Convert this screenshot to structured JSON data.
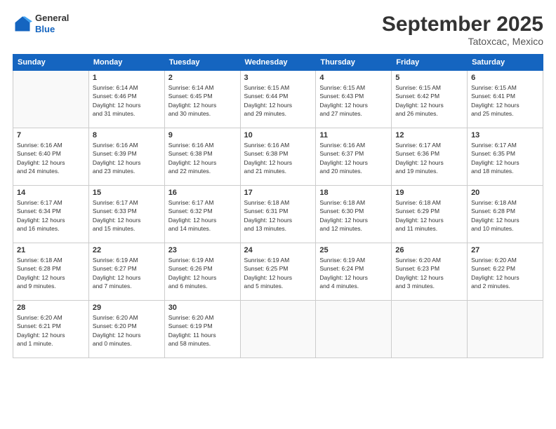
{
  "logo": {
    "line1": "General",
    "line2": "Blue"
  },
  "title": "September 2025",
  "subtitle": "Tatoxcac, Mexico",
  "days_of_week": [
    "Sunday",
    "Monday",
    "Tuesday",
    "Wednesday",
    "Thursday",
    "Friday",
    "Saturday"
  ],
  "weeks": [
    [
      {
        "day": "",
        "info": ""
      },
      {
        "day": "1",
        "info": "Sunrise: 6:14 AM\nSunset: 6:46 PM\nDaylight: 12 hours\nand 31 minutes."
      },
      {
        "day": "2",
        "info": "Sunrise: 6:14 AM\nSunset: 6:45 PM\nDaylight: 12 hours\nand 30 minutes."
      },
      {
        "day": "3",
        "info": "Sunrise: 6:15 AM\nSunset: 6:44 PM\nDaylight: 12 hours\nand 29 minutes."
      },
      {
        "day": "4",
        "info": "Sunrise: 6:15 AM\nSunset: 6:43 PM\nDaylight: 12 hours\nand 27 minutes."
      },
      {
        "day": "5",
        "info": "Sunrise: 6:15 AM\nSunset: 6:42 PM\nDaylight: 12 hours\nand 26 minutes."
      },
      {
        "day": "6",
        "info": "Sunrise: 6:15 AM\nSunset: 6:41 PM\nDaylight: 12 hours\nand 25 minutes."
      }
    ],
    [
      {
        "day": "7",
        "info": "Sunrise: 6:16 AM\nSunset: 6:40 PM\nDaylight: 12 hours\nand 24 minutes."
      },
      {
        "day": "8",
        "info": "Sunrise: 6:16 AM\nSunset: 6:39 PM\nDaylight: 12 hours\nand 23 minutes."
      },
      {
        "day": "9",
        "info": "Sunrise: 6:16 AM\nSunset: 6:38 PM\nDaylight: 12 hours\nand 22 minutes."
      },
      {
        "day": "10",
        "info": "Sunrise: 6:16 AM\nSunset: 6:38 PM\nDaylight: 12 hours\nand 21 minutes."
      },
      {
        "day": "11",
        "info": "Sunrise: 6:16 AM\nSunset: 6:37 PM\nDaylight: 12 hours\nand 20 minutes."
      },
      {
        "day": "12",
        "info": "Sunrise: 6:17 AM\nSunset: 6:36 PM\nDaylight: 12 hours\nand 19 minutes."
      },
      {
        "day": "13",
        "info": "Sunrise: 6:17 AM\nSunset: 6:35 PM\nDaylight: 12 hours\nand 18 minutes."
      }
    ],
    [
      {
        "day": "14",
        "info": "Sunrise: 6:17 AM\nSunset: 6:34 PM\nDaylight: 12 hours\nand 16 minutes."
      },
      {
        "day": "15",
        "info": "Sunrise: 6:17 AM\nSunset: 6:33 PM\nDaylight: 12 hours\nand 15 minutes."
      },
      {
        "day": "16",
        "info": "Sunrise: 6:17 AM\nSunset: 6:32 PM\nDaylight: 12 hours\nand 14 minutes."
      },
      {
        "day": "17",
        "info": "Sunrise: 6:18 AM\nSunset: 6:31 PM\nDaylight: 12 hours\nand 13 minutes."
      },
      {
        "day": "18",
        "info": "Sunrise: 6:18 AM\nSunset: 6:30 PM\nDaylight: 12 hours\nand 12 minutes."
      },
      {
        "day": "19",
        "info": "Sunrise: 6:18 AM\nSunset: 6:29 PM\nDaylight: 12 hours\nand 11 minutes."
      },
      {
        "day": "20",
        "info": "Sunrise: 6:18 AM\nSunset: 6:28 PM\nDaylight: 12 hours\nand 10 minutes."
      }
    ],
    [
      {
        "day": "21",
        "info": "Sunrise: 6:18 AM\nSunset: 6:28 PM\nDaylight: 12 hours\nand 9 minutes."
      },
      {
        "day": "22",
        "info": "Sunrise: 6:19 AM\nSunset: 6:27 PM\nDaylight: 12 hours\nand 7 minutes."
      },
      {
        "day": "23",
        "info": "Sunrise: 6:19 AM\nSunset: 6:26 PM\nDaylight: 12 hours\nand 6 minutes."
      },
      {
        "day": "24",
        "info": "Sunrise: 6:19 AM\nSunset: 6:25 PM\nDaylight: 12 hours\nand 5 minutes."
      },
      {
        "day": "25",
        "info": "Sunrise: 6:19 AM\nSunset: 6:24 PM\nDaylight: 12 hours\nand 4 minutes."
      },
      {
        "day": "26",
        "info": "Sunrise: 6:20 AM\nSunset: 6:23 PM\nDaylight: 12 hours\nand 3 minutes."
      },
      {
        "day": "27",
        "info": "Sunrise: 6:20 AM\nSunset: 6:22 PM\nDaylight: 12 hours\nand 2 minutes."
      }
    ],
    [
      {
        "day": "28",
        "info": "Sunrise: 6:20 AM\nSunset: 6:21 PM\nDaylight: 12 hours\nand 1 minute."
      },
      {
        "day": "29",
        "info": "Sunrise: 6:20 AM\nSunset: 6:20 PM\nDaylight: 12 hours\nand 0 minutes."
      },
      {
        "day": "30",
        "info": "Sunrise: 6:20 AM\nSunset: 6:19 PM\nDaylight: 11 hours\nand 58 minutes."
      },
      {
        "day": "",
        "info": ""
      },
      {
        "day": "",
        "info": ""
      },
      {
        "day": "",
        "info": ""
      },
      {
        "day": "",
        "info": ""
      }
    ]
  ]
}
